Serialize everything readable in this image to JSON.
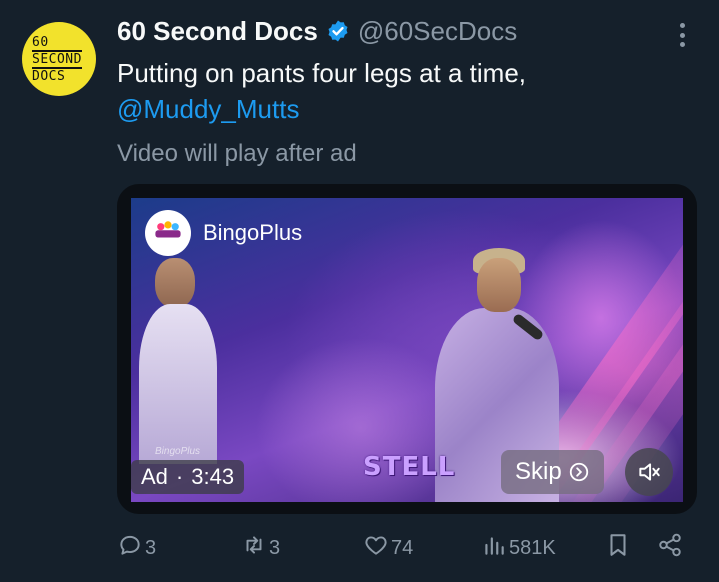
{
  "tweet": {
    "author": {
      "display_name": "60 Second Docs",
      "handle": "@60SecDocs",
      "avatar_text": [
        "60",
        "SECOND",
        "DOCS"
      ],
      "verified": true
    },
    "text": "Putting on pants four legs at a time,",
    "mention": "@Muddy_Mutts",
    "notice": "Video will play after ad"
  },
  "video_ad": {
    "advertiser": "BingoPlus",
    "ad_label": "Ad",
    "separator": "·",
    "countdown": "3:43",
    "skip_label": "Skip",
    "overlay_caption": "STELL",
    "watermark": "BingoPlus"
  },
  "actions": {
    "replies": "3",
    "reposts": "3",
    "likes": "74",
    "views": "581K"
  },
  "colors": {
    "background": "#15202b",
    "text_primary": "#f7f9f9",
    "text_secondary": "#8b98a5",
    "accent_blue": "#1d9bf0",
    "avatar_yellow": "#f2e22c"
  },
  "icons": {
    "verified": "verified-badge-icon",
    "more": "more-options-icon",
    "reply": "reply-icon",
    "repost": "repost-icon",
    "like": "heart-icon",
    "views": "views-chart-icon",
    "bookmark": "bookmark-icon",
    "share": "share-icon",
    "mute": "muted-speaker-icon",
    "skip": "skip-arrow-icon"
  }
}
